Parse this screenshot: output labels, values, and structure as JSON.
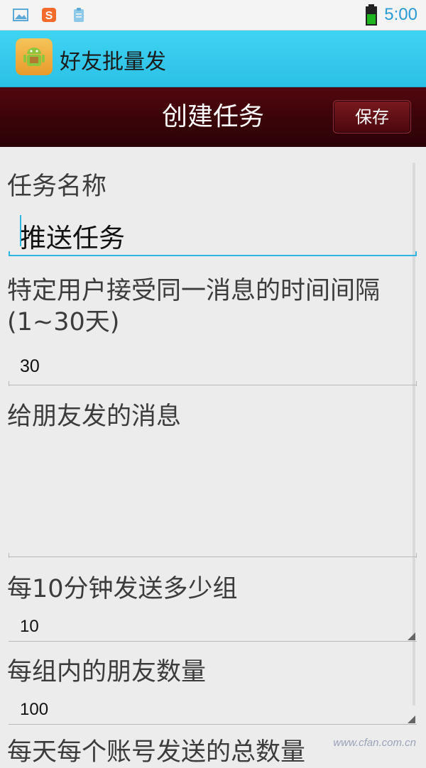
{
  "status_bar": {
    "time": "5:00",
    "notification_icons": [
      "image-icon",
      "sogou-icon",
      "clipboard-icon"
    ],
    "battery_color": "#1fb51f"
  },
  "app_bar": {
    "title": "好友批量发"
  },
  "header": {
    "title": "创建任务",
    "save_label": "保存"
  },
  "form": {
    "task_name": {
      "label": "任务名称",
      "value": "推送任务"
    },
    "interval": {
      "label": "特定用户接受同一消息的时间间隔(1~30天)",
      "value": "30"
    },
    "message": {
      "label": "给朋友发的消息",
      "value": ""
    },
    "groups_per_10min": {
      "label": "每10分钟发送多少组",
      "value": "10"
    },
    "friends_per_group": {
      "label": "每组内的朋友数量",
      "value": "100"
    },
    "next_label_partial": "每天每个账号发送的总数量"
  },
  "watermark": "www.cfan.com.cn",
  "accent_color": "#2fb6e0",
  "header_color": "#3a0409"
}
